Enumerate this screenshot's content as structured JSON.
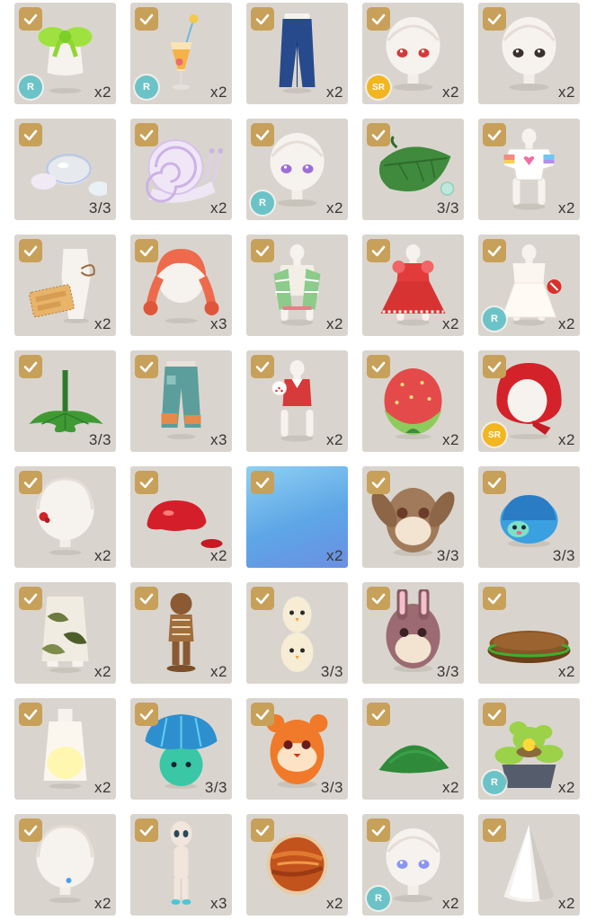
{
  "colors": {
    "tile_bg": "#d9d5ce",
    "check_bg": "#c7a05a",
    "rarity_r": "#6cc3c7",
    "rarity_sr": "#f2b61f",
    "quantity_text": "#3a3632"
  },
  "items": [
    {
      "icon": "green-bow-top-icon",
      "qty": "x2",
      "rarity": "R",
      "checked": true
    },
    {
      "icon": "cocktail-glass-icon",
      "qty": "x2",
      "rarity": "R",
      "checked": true
    },
    {
      "icon": "blue-jeans-icon",
      "qty": "x2",
      "rarity": "",
      "checked": true
    },
    {
      "icon": "red-eyes-face-icon",
      "qty": "x2",
      "rarity": "SR",
      "checked": true
    },
    {
      "icon": "dark-eyes-face-icon",
      "qty": "x2",
      "rarity": "",
      "checked": true
    },
    {
      "icon": "bubbles-icon",
      "qty": "3/3",
      "rarity": "",
      "checked": true
    },
    {
      "icon": "pearl-snail-icon",
      "qty": "x2",
      "rarity": "",
      "checked": true
    },
    {
      "icon": "purple-eyes-face-icon",
      "qty": "x2",
      "rarity": "R",
      "checked": true
    },
    {
      "icon": "leaf-with-dewdrop-icon",
      "qty": "3/3",
      "rarity": "",
      "checked": true
    },
    {
      "icon": "rainbow-heart-tee-icon",
      "qty": "x2",
      "rarity": "",
      "checked": true
    },
    {
      "icon": "strawberry-jam-tag-icon",
      "qty": "x2",
      "rarity": "",
      "checked": true
    },
    {
      "icon": "red-pigtails-hair-icon",
      "qty": "x3",
      "rarity": "",
      "checked": true
    },
    {
      "icon": "green-plaid-top-icon",
      "qty": "x2",
      "rarity": "",
      "checked": true
    },
    {
      "icon": "red-gingham-dress-icon",
      "qty": "x2",
      "rarity": "",
      "checked": true
    },
    {
      "icon": "white-ruffle-dress-icon",
      "qty": "x2",
      "rarity": "R",
      "checked": true
    },
    {
      "icon": "green-leaf-collar-icon",
      "qty": "3/3",
      "rarity": "",
      "checked": true
    },
    {
      "icon": "teal-patchwork-pants-icon",
      "qty": "x3",
      "rarity": "",
      "checked": true
    },
    {
      "icon": "red-vest-top-icon",
      "qty": "x2",
      "rarity": "",
      "checked": true
    },
    {
      "icon": "strawberry-egg-icon",
      "qty": "x2",
      "rarity": "",
      "checked": true
    },
    {
      "icon": "red-hood-icon",
      "qty": "x2",
      "rarity": "SR",
      "checked": true
    },
    {
      "icon": "white-hair-red-clip-icon",
      "qty": "x2",
      "rarity": "",
      "checked": true
    },
    {
      "icon": "red-jam-splash-icon",
      "qty": "x2",
      "rarity": "",
      "checked": true
    },
    {
      "icon": "blue-water-background-icon",
      "qty": "x2",
      "rarity": "",
      "checked": true
    },
    {
      "icon": "brown-bunny-pet-icon",
      "qty": "3/3",
      "rarity": "",
      "checked": true
    },
    {
      "icon": "blue-hedgehog-pet-icon",
      "qty": "3/3",
      "rarity": "",
      "checked": true
    },
    {
      "icon": "leaf-print-skirt-icon",
      "qty": "x2",
      "rarity": "",
      "checked": true
    },
    {
      "icon": "wooden-doll-figure-icon",
      "qty": "x2",
      "rarity": "",
      "checked": true
    },
    {
      "icon": "twin-chick-eggs-icon",
      "qty": "3/3",
      "rarity": "",
      "checked": true
    },
    {
      "icon": "purple-bunny-egg-icon",
      "qty": "3/3",
      "rarity": "",
      "checked": true
    },
    {
      "icon": "wooden-round-stage-icon",
      "qty": "x2",
      "rarity": "",
      "checked": true
    },
    {
      "icon": "white-glow-dress-icon",
      "qty": "x2",
      "rarity": "",
      "checked": true
    },
    {
      "icon": "teal-mushroom-pet-icon",
      "qty": "3/3",
      "rarity": "",
      "checked": true
    },
    {
      "icon": "orange-hamster-pet-icon",
      "qty": "3/3",
      "rarity": "",
      "checked": true
    },
    {
      "icon": "grass-mound-icon",
      "qty": "x2",
      "rarity": "",
      "checked": true
    },
    {
      "icon": "chick-nest-plant-icon",
      "qty": "x2",
      "rarity": "R",
      "checked": true
    },
    {
      "icon": "white-hair-blue-clip-icon",
      "qty": "x2",
      "rarity": "",
      "checked": true
    },
    {
      "icon": "pale-alien-figure-icon",
      "qty": "x3",
      "rarity": "",
      "checked": true
    },
    {
      "icon": "orange-planet-icon",
      "qty": "x2",
      "rarity": "",
      "checked": true
    },
    {
      "icon": "blue-eyes-face-icon",
      "qty": "x2",
      "rarity": "R",
      "checked": true
    },
    {
      "icon": "white-cone-icon",
      "qty": "x2",
      "rarity": "",
      "checked": true
    }
  ]
}
